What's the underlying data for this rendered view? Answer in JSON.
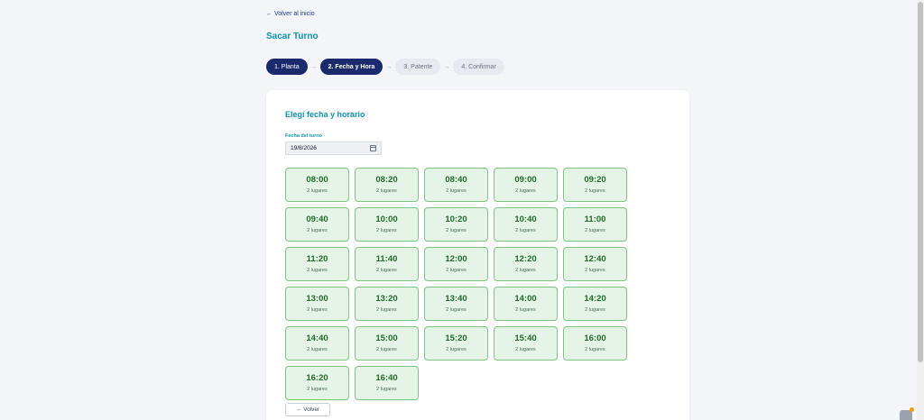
{
  "nav": {
    "back_home": "← Volver al inicio"
  },
  "page": {
    "title": "Sacar Turno"
  },
  "steps": [
    {
      "label": "1. Planta",
      "state": "done"
    },
    {
      "label": "2. Fecha y Hora",
      "state": "active"
    },
    {
      "label": "3. Patente",
      "state": "pending"
    },
    {
      "label": "4. Confirmar",
      "state": "pending"
    }
  ],
  "step_separator": "→",
  "card": {
    "title": "Elegí fecha y horario",
    "date_label": "Fecha del turno",
    "date_value": "19/8/2026",
    "back_button": "← Volver"
  },
  "slots": [
    {
      "time": "08:00",
      "avail": "2 lugares"
    },
    {
      "time": "08:20",
      "avail": "2 lugares"
    },
    {
      "time": "08:40",
      "avail": "2 lugares"
    },
    {
      "time": "09:00",
      "avail": "2 lugares"
    },
    {
      "time": "09:20",
      "avail": "2 lugares"
    },
    {
      "time": "09:40",
      "avail": "2 lugares"
    },
    {
      "time": "10:00",
      "avail": "2 lugares"
    },
    {
      "time": "10:20",
      "avail": "2 lugares"
    },
    {
      "time": "10:40",
      "avail": "2 lugares"
    },
    {
      "time": "11:00",
      "avail": "2 lugares"
    },
    {
      "time": "11:20",
      "avail": "2 lugares"
    },
    {
      "time": "11:40",
      "avail": "2 lugares"
    },
    {
      "time": "12:00",
      "avail": "2 lugares"
    },
    {
      "time": "12:20",
      "avail": "2 lugares"
    },
    {
      "time": "12:40",
      "avail": "2 lugares"
    },
    {
      "time": "13:00",
      "avail": "2 lugares"
    },
    {
      "time": "13:20",
      "avail": "2 lugares"
    },
    {
      "time": "13:40",
      "avail": "2 lugares"
    },
    {
      "time": "14:00",
      "avail": "2 lugares"
    },
    {
      "time": "14:20",
      "avail": "2 lugares"
    },
    {
      "time": "14:40",
      "avail": "2 lugares"
    },
    {
      "time": "15:00",
      "avail": "2 lugares"
    },
    {
      "time": "15:20",
      "avail": "2 lugares"
    },
    {
      "time": "15:40",
      "avail": "2 lugares"
    },
    {
      "time": "16:00",
      "avail": "2 lugares"
    },
    {
      "time": "16:20",
      "avail": "2 lugares"
    },
    {
      "time": "16:40",
      "avail": "2 lugares"
    }
  ],
  "colors": {
    "primary": "#1a2a6c",
    "accent": "#0e93b8",
    "slot_bg": "#e6f4e7",
    "slot_border": "#7cc47f",
    "slot_text": "#1f6b2a"
  },
  "icons": {
    "date": "calendar-icon",
    "widget": "cart-icon"
  }
}
